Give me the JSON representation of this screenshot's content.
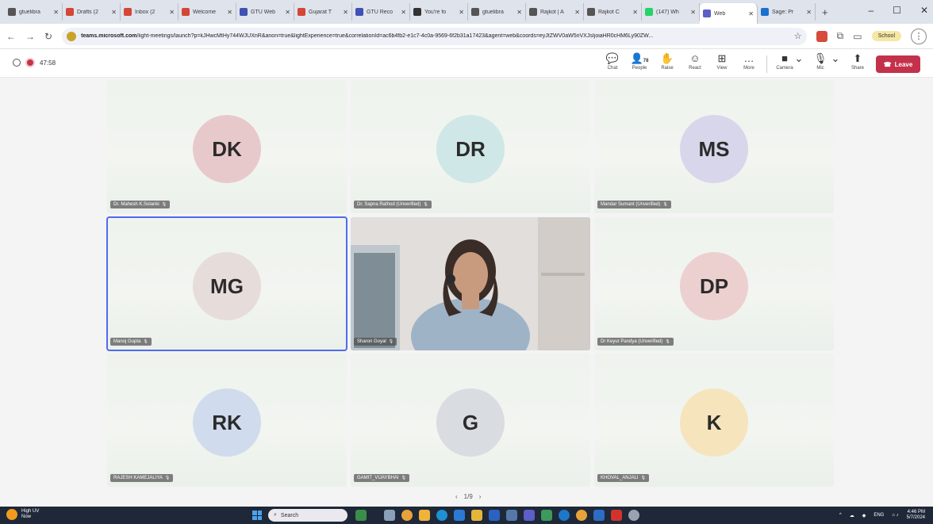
{
  "browser": {
    "tabs": [
      {
        "title": "gtuelibra",
        "color": "#555555"
      },
      {
        "title": "Drafts (2",
        "color": "#d44638"
      },
      {
        "title": "Inbox (2",
        "color": "#d44638"
      },
      {
        "title": "Welcome",
        "color": "#d44638"
      },
      {
        "title": "GTU Web",
        "color": "#3f51b5"
      },
      {
        "title": "Gujarat T",
        "color": "#d44638"
      },
      {
        "title": "GTU Reco",
        "color": "#3f51b5"
      },
      {
        "title": "You're fo",
        "color": "#333333"
      },
      {
        "title": "gtuelibra",
        "color": "#555555"
      },
      {
        "title": "Rajkot | A",
        "color": "#555555"
      },
      {
        "title": "Rajkot C",
        "color": "#555555"
      },
      {
        "title": "(147) Wh",
        "color": "#25d366"
      },
      {
        "title": "Web",
        "color": "#5b5fc7",
        "active": true
      },
      {
        "title": "Sage: Pr",
        "color": "#1a6fd1"
      }
    ],
    "new_tab_label": "+",
    "window_controls": [
      "–",
      "☐",
      "✕"
    ],
    "url_host": "teams.microsoft.com",
    "url_path": "/light-meetings/launch?p=kJHwcMtHy744WJUXnR&anon=true&lightExperience=true&correlationId=ac6b4fb2-e1c7-4c0a-9569-6f2b31a17423&agent=web&coords=eyJtZWV0aW5nVXJsIjoiaHR0cHM6Ly90ZW...",
    "profile_label": "School"
  },
  "meeting": {
    "elapsed": "47:58",
    "toolbar": {
      "chat": "Chat",
      "people": "People",
      "people_count": "78",
      "raise": "Raise",
      "react": "React",
      "view": "View",
      "more": "More",
      "camera": "Camera",
      "mic": "Mic",
      "share": "Share",
      "leave": "Leave"
    },
    "participants": [
      {
        "initials": "DK",
        "name": "Dr. Mahesh K.Solanki",
        "avatar_color": "#e8c9cb"
      },
      {
        "initials": "DR",
        "name": "Dr. Sapna Rathod (Unverified)",
        "avatar_color": "#cfe7e6"
      },
      {
        "initials": "MS",
        "name": "Mandar Sumant (Unverified)",
        "avatar_color": "#d7d6ea"
      },
      {
        "initials": "MG",
        "name": "Manoj Gupta",
        "avatar_color": "#e6dcd9"
      },
      {
        "initials": "",
        "name": "Sharon Goyal",
        "avatar_color": "#d9d5d2",
        "video": true
      },
      {
        "initials": "DP",
        "name": "Dr Keyur Pandya (Unverified)",
        "avatar_color": "#ecd0d0"
      },
      {
        "initials": "RK",
        "name": "RAJESH KAMEJALIYA",
        "avatar_color": "#d0dced"
      },
      {
        "initials": "G",
        "name": "GAMIT_VIJAYBHAI",
        "avatar_color": "#d9dde1"
      },
      {
        "initials": "K",
        "name": "KHOVAL_ANJALI",
        "avatar_color": "#f6e4bd"
      }
    ],
    "page_indicator": "1/9"
  },
  "taskbar": {
    "weather_title": "High UV",
    "weather_sub": "Now",
    "search_placeholder": "Search",
    "tray_lang": "ENG",
    "time": "4:46 PM",
    "date": "5/7/2024"
  }
}
